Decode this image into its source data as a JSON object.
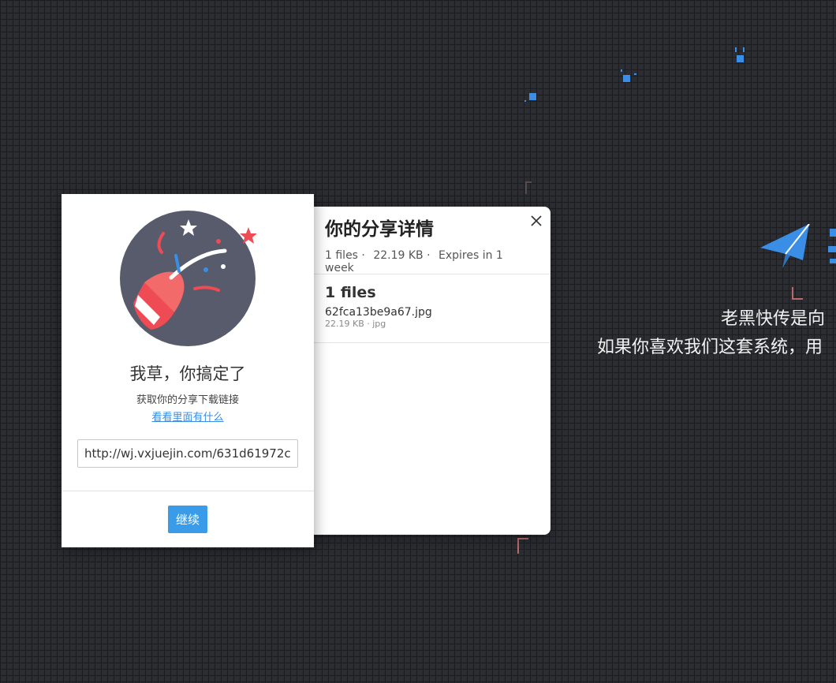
{
  "details": {
    "title": "你的分享详情",
    "meta": {
      "file_count": "1 files ·",
      "size": "22.19 KB ·",
      "expiry": "Expires in 1 week"
    },
    "files_heading": "1 files",
    "files": [
      {
        "name": "62fca13be9a67.jpg",
        "size": "22.19 KB ·",
        "type": "jpg"
      }
    ]
  },
  "success": {
    "title": "我草，你搞定了",
    "subtitle": "获取你的分享下载链接",
    "link_text": "看看里面有什么",
    "share_url": "http://wj.vxjuejin.com/631d61972c",
    "continue_label": "继续"
  },
  "hero": {
    "line1": "老黑快传是向",
    "line2": "如果你喜欢我们这套系统，用"
  },
  "colors": {
    "accent": "#3a9be8",
    "background": "#2b2d33"
  }
}
